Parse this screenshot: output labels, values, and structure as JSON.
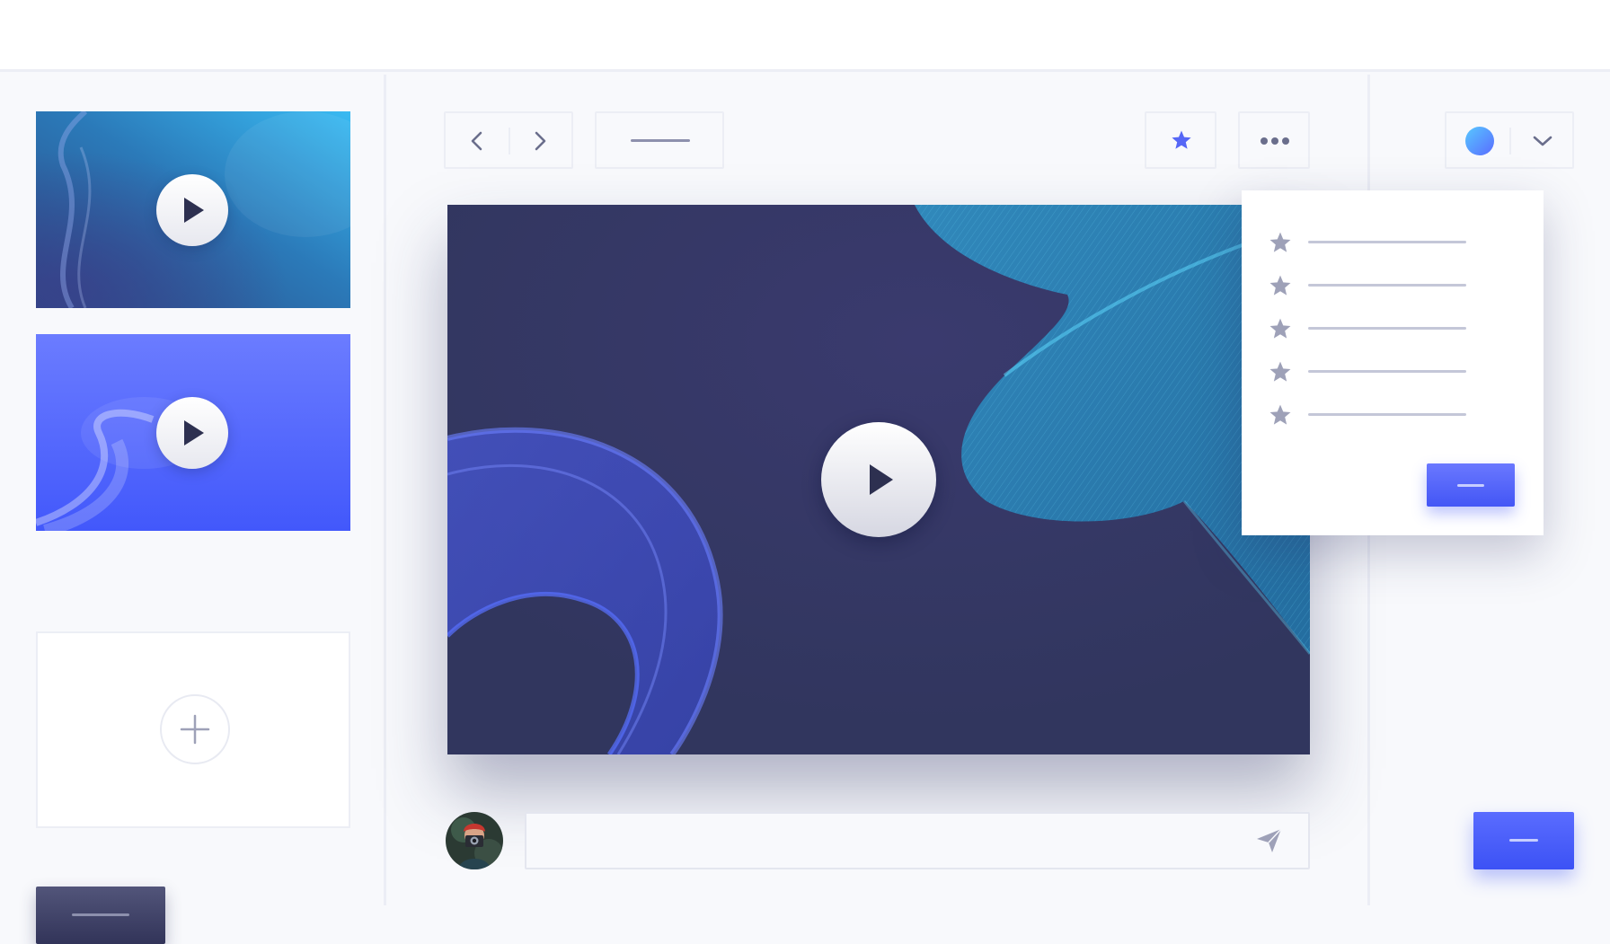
{
  "comment_box": {
    "value": "",
    "placeholder": ""
  },
  "icons": {
    "nav_back": "chevron-left-icon",
    "nav_forward": "chevron-right-icon",
    "favorite": "star-icon",
    "more": "ellipsis-icon",
    "account_menu": "chevron-down-icon",
    "play": "play-icon",
    "add": "plus-icon",
    "send": "send-icon"
  },
  "colors": {
    "accent": "#4356f5",
    "dark_button": "#3a3c62",
    "video_background": "#33375f",
    "muted_icon": "#9ea1b8"
  }
}
